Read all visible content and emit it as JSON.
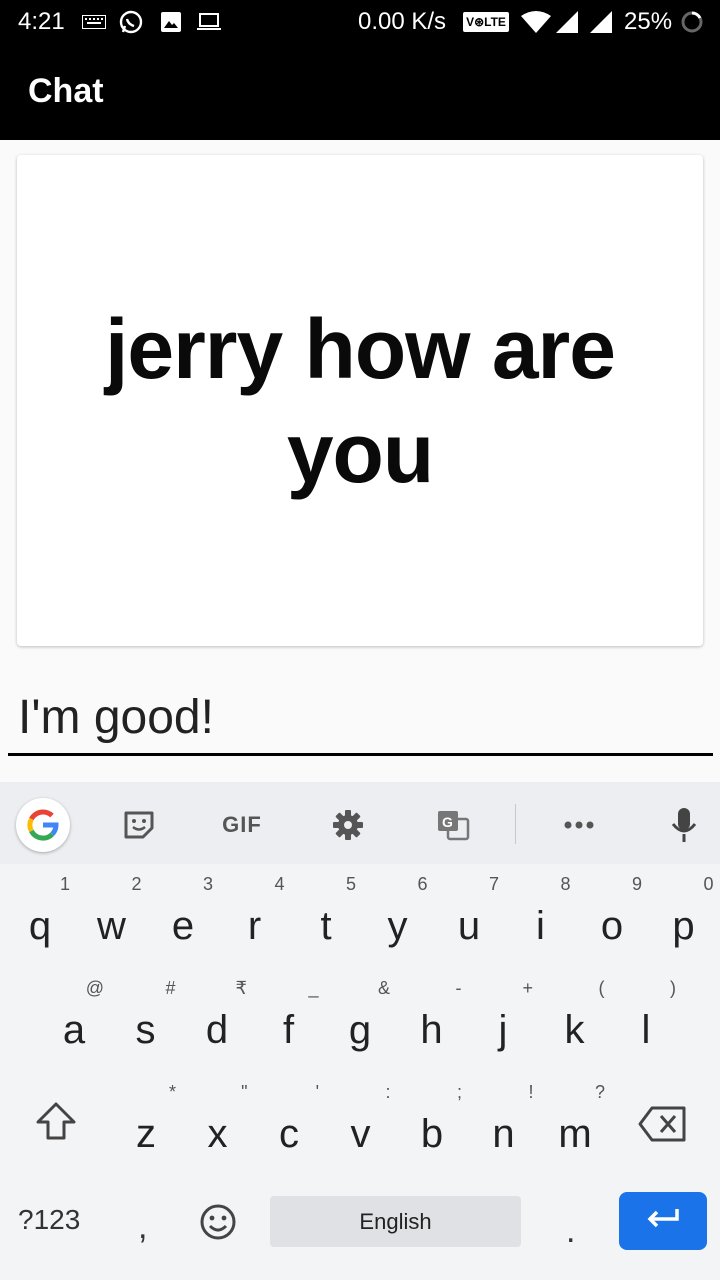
{
  "status_bar": {
    "time": "4:21",
    "network_speed": "0.00 K/s",
    "volte": "V⊛LTE",
    "battery": "25%"
  },
  "app_bar": {
    "title": "Chat"
  },
  "message": {
    "text": "jerry how are you"
  },
  "reply": {
    "value": "I'm good!"
  },
  "keyboard": {
    "toolbar": {
      "gif_label": "GIF"
    },
    "rows": [
      [
        {
          "key": "q",
          "hint": "1"
        },
        {
          "key": "w",
          "hint": "2"
        },
        {
          "key": "e",
          "hint": "3"
        },
        {
          "key": "r",
          "hint": "4"
        },
        {
          "key": "t",
          "hint": "5"
        },
        {
          "key": "y",
          "hint": "6"
        },
        {
          "key": "u",
          "hint": "7"
        },
        {
          "key": "i",
          "hint": "8"
        },
        {
          "key": "o",
          "hint": "9"
        },
        {
          "key": "p",
          "hint": "0"
        }
      ],
      [
        {
          "key": "a",
          "hint": "@"
        },
        {
          "key": "s",
          "hint": "#"
        },
        {
          "key": "d",
          "hint": "₹"
        },
        {
          "key": "f",
          "hint": "_"
        },
        {
          "key": "g",
          "hint": "&"
        },
        {
          "key": "h",
          "hint": "-"
        },
        {
          "key": "j",
          "hint": "+"
        },
        {
          "key": "k",
          "hint": "("
        },
        {
          "key": "l",
          "hint": ")"
        }
      ],
      [
        {
          "key": "z",
          "hint": "*"
        },
        {
          "key": "x",
          "hint": "\""
        },
        {
          "key": "c",
          "hint": "'"
        },
        {
          "key": "v",
          "hint": ":"
        },
        {
          "key": "b",
          "hint": ";"
        },
        {
          "key": "n",
          "hint": "!"
        },
        {
          "key": "m",
          "hint": "?"
        }
      ]
    ],
    "symbols_label": "?123",
    "comma": ",",
    "space_label": "English",
    "period": ".",
    "accent_color": "#1a73e8"
  }
}
